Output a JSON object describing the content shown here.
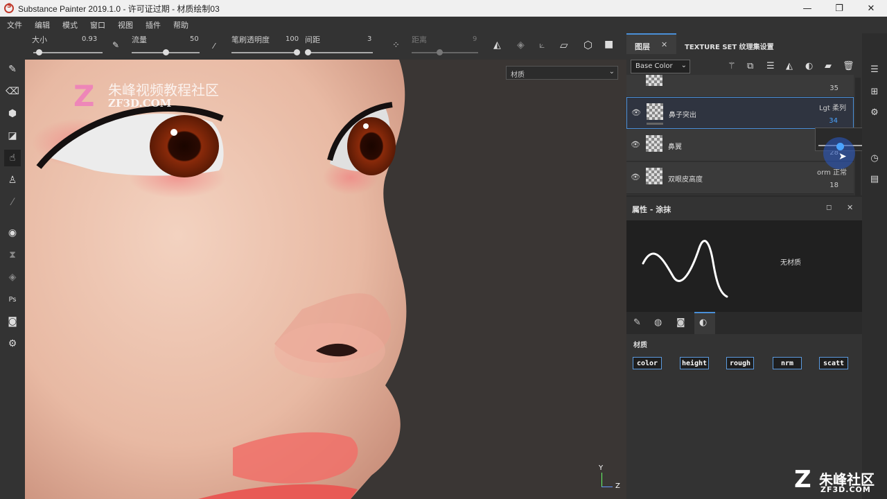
{
  "window": {
    "title": "Substance Painter 2019.1.0 - 许可证过期 - 材质绘制03",
    "minimize": "—",
    "maximize": "❐",
    "close": "✕"
  },
  "menu": [
    "文件",
    "编辑",
    "模式",
    "窗口",
    "视图",
    "插件",
    "帮助"
  ],
  "toolbar": {
    "size_label": "大小",
    "size_value": "0.93",
    "flow_label": "流量",
    "flow_value": "50",
    "opacity_label": "笔刷透明度",
    "opacity_value": "100",
    "spacing_label": "间距",
    "spacing_value": "3",
    "distance_label": "距离",
    "distance_value": "9"
  },
  "viewport": {
    "material_dropdown": "材质",
    "watermark_cn": "朱峰视频教程社区",
    "watermark_en": "ZF3D.COM",
    "corner_logo_cn": "朱峰社区",
    "corner_logo_en": "ZF3D.COM",
    "axis_y": "Y",
    "axis_z": "Z"
  },
  "layers_panel": {
    "tab_layers": "图层",
    "tab_texture_set": "TEXTURE SET 纹理集设置",
    "channel_dropdown": "Base Color",
    "top_partial_opacity": "35",
    "rows": [
      {
        "name": "鼻子突出",
        "blend": "Lgt 柔列",
        "opacity": "34",
        "selected": true
      },
      {
        "name": "鼻翼",
        "blend": "",
        "opacity": "28",
        "selected": false
      },
      {
        "name": "双眼皮高度",
        "blend": "orm 正常",
        "opacity": "18",
        "selected": false
      }
    ],
    "popup_slider_value": "34"
  },
  "properties_panel": {
    "title": "属性 - 涂抹",
    "no_material": "无材质",
    "section_label": "材质",
    "channels": [
      "color",
      "height",
      "rough",
      "nrm",
      "scatt"
    ]
  },
  "colors": {
    "accent": "#4a90d9",
    "panel_bg": "#333333",
    "viewport_bg": "#3a3634"
  }
}
